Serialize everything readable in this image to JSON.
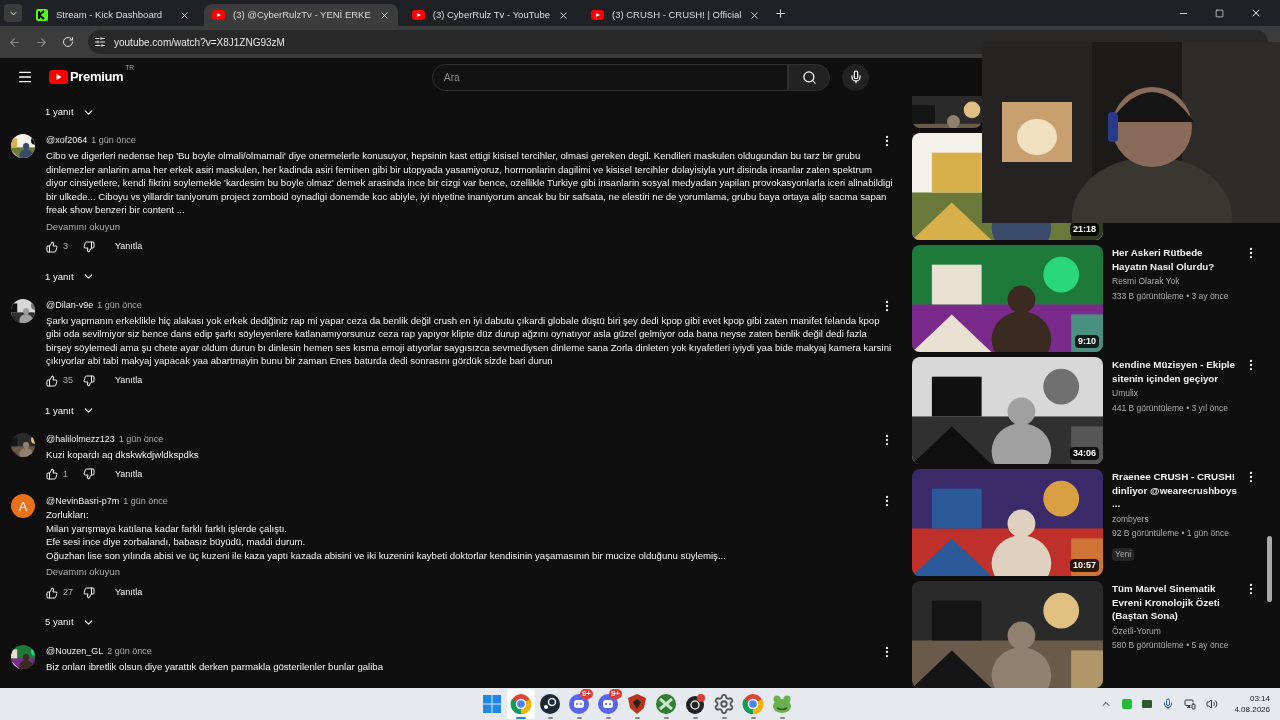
{
  "browser": {
    "tabs": [
      {
        "title": "Stream - Kick Dashboard",
        "kind": "kick",
        "selected": false
      },
      {
        "title": "(3) @CyberRulzTv - YENİ ERKE",
        "kind": "youtube",
        "selected": true
      },
      {
        "title": "(3) CyberRulz Tv - YouTube",
        "kind": "youtube",
        "selected": false
      },
      {
        "title": "(3) CRUSH - CRUSH! | Official",
        "kind": "youtube",
        "selected": false
      }
    ],
    "url": "youtube.com/watch?v=X8J1ZNG93zM"
  },
  "header": {
    "logo_text": "Premium",
    "region": "TR",
    "search_placeholder": "Ara"
  },
  "comments": [
    {
      "kind": "replies",
      "label": "1 yanıt"
    },
    {
      "kind": "comment",
      "author": "@xof2064",
      "time": "1 gün önce",
      "text": "Cibo ve digerleri nedense hep 'Bu boyle olmali/olmamali' diye onermelerle konusuyor, hepsinin kast ettigi kisisel tercihler, olmasi gereken degil. Kendileri maskulen oldugundan bu tarz bir grubu dinlemezler anlarim ama her erkek asiri maskulen, her kadinda asiri feminen gibi bir utopyada yasamiyoruz, hormonlarin dagilimi ve kisisel tercihler dolayisiyla yurt disinda insanlar zaten spektrum diyor cinsiyetlere, kendi fikrini soylemekle 'kardesim bu boyle olmaz' demek arasinda ince bir cizgi var bence, ozellikle Turkiye gibi insanlarin sosyal medyadan yapilan provokasyonlarla iceri alinabildigi bir ulkede... Ciboyu vs yillardir taniyorum project zomboid oynadigi donemde koc abiyle, iyi niyetine inaniyorum ancak bu bir safsata, ne elestiri ne de yorumlama, grubu baya ortaya alip sacma sapan freak show benzeri bir content ...",
      "more": "Devamını okuyun",
      "likes": "3",
      "reply": "Yanıtla"
    },
    {
      "kind": "replies",
      "label": "1 yanıt"
    },
    {
      "kind": "comment",
      "author": "@Dilan-v9e",
      "time": "1 gün önce",
      "text": "Şarkı yapmanın erkeklikle hiç alakası yok erkek dediğiniz rap mi yapar  ceza da benlik değil crush en iyi dabutu çıkardi globale düştü biri şey dedi kpop gibi evet kpop gibi zaten manifet felanda kpop gibi oda sevilmiyor siz bence dans edip şarkı söyleyenlere katlanamıyorsunuz ceza rap yapıyor klipte düz durup ağzını oynatıyor asla güzel gelmiyor oda bana neyse zaten benlik değil dedi fazla birşey söylemedi ama şu chete ayar oldum durun bı dinlesin hemen ses kısma emoji atıyorlar saygısızca sevmediysen dinleme sana Zorla dinleten yok kıyafetleri iyiydi yaa bide makyaj kamera karsini çıkıyorlar abi tabi makyaj yapacak yaa abartmayin bunu bir zaman Enes baturda dedi sonrasını gördük sizde bari durun",
      "likes": "35",
      "reply": "Yanıtla"
    },
    {
      "kind": "replies",
      "label": "1 yanıt"
    },
    {
      "kind": "comment",
      "author": "@halilolmezz123",
      "time": "1 gün önce",
      "text": "Kuzi kopardı aq dkskwkdjwldkspdks",
      "likes": "1",
      "reply": "Yanıtla"
    },
    {
      "kind": "comment",
      "author": "@NevinBasri-p7m",
      "time": "1 gün önce",
      "letter": "A",
      "color": "#e8711a",
      "lines": [
        "Zorlukları:",
        "Milan yarışmaya katılana kadar farklı farklı işlerde çalıştı.",
        "Efe sesi ince diye zorbalandı, babasız büyüdü, maddi durum.",
        "Oğuzhan lise son yılında abisi ve üç kuzeni ile kaza yaptı kazada abisini ve iki kuzenini kaybeti doktorlar kendisinin yaşamasının bir mucize olduğunu süylemiş..."
      ],
      "more": "Devamını okuyun",
      "likes": "27",
      "reply": "Yanıtla"
    },
    {
      "kind": "replies",
      "label": "5 yanıt"
    },
    {
      "kind": "comment",
      "author": "@Nouzen_GL",
      "time": "2 gün önce",
      "text": "Biz onları ibretlik olsun diye yarattık derken parmakla gösterilenler bunlar galiba"
    }
  ],
  "sidebar": [
    {
      "kind": "partial"
    },
    {
      "kind": "video",
      "duration": "21:18"
    },
    {
      "kind": "video",
      "title": "Her Askeri Rütbede Hayatın Nasıl Olurdu?",
      "channel": "Resmi Olarak Yok",
      "meta": "333 B görüntüleme • 3 ay önce",
      "duration": "9:10"
    },
    {
      "kind": "video",
      "title": "Kendine Müzisyen - Ekiple sitenin içinden geçiyor",
      "channel": "Umulix",
      "meta": "441 B görüntüleme • 3 yıl önce",
      "duration": "34:06"
    },
    {
      "kind": "video",
      "title": "Rraenee CRUSH - CRUSH! dinliyor @wearecrushboys ...",
      "channel": "zombyers",
      "meta": "92 B görüntüleme • 1 gün önce",
      "duration": "10:57",
      "new": true,
      "new_label": "Yeni"
    },
    {
      "kind": "video",
      "title": "Tüm Marvel Sinematik Evreni Kronolojik Özeti (Baştan Sona)",
      "channel": "Özetli-Yorum",
      "meta": "580 B görüntüleme • 5 ay önce"
    }
  ],
  "taskbar": {
    "apps": [
      {
        "kind": "start"
      },
      {
        "kind": "browser",
        "active": true
      },
      {
        "kind": "steam",
        "active": false
      },
      {
        "kind": "chat",
        "badge": "9+",
        "active": false
      },
      {
        "kind": "chat",
        "badge": "9+",
        "active": false
      },
      {
        "kind": "shield",
        "active": false
      },
      {
        "kind": "game",
        "active": false
      },
      {
        "kind": "recorder",
        "active": false
      },
      {
        "kind": "settings",
        "active": false
      },
      {
        "kind": "browser",
        "active": false
      },
      {
        "kind": "frog",
        "active": false
      }
    ],
    "time": "03:14",
    "date": "4.08.2026"
  }
}
